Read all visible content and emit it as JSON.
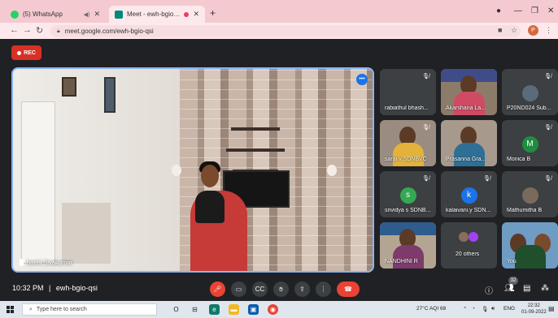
{
  "browser": {
    "tabs": [
      {
        "title": "(5) WhatsApp",
        "active": false,
        "favicon_color": "#25d366"
      },
      {
        "title": "Meet - ewh-bgio-qsi",
        "active": true,
        "favicon_color": "#00897b"
      }
    ],
    "url": "meet.google.com/ewh-bgio-qsi",
    "new_tab_label": "+",
    "profile_initial": "P"
  },
  "meet": {
    "rec_label": "REC",
    "main_speaker": "harini Sivakumar",
    "participants": [
      {
        "name": "rabiathul bhash...",
        "kind": "blank"
      },
      {
        "name": "Akarshana La...",
        "kind": "photo"
      },
      {
        "name": "P20ND024 Sub...",
        "kind": "avatar",
        "initial": "",
        "color": "#5b6b7a"
      },
      {
        "name": "sarai v SDNBVC",
        "kind": "photo"
      },
      {
        "name": "Prasanna Gra...",
        "kind": "photo"
      },
      {
        "name": "Monica B",
        "kind": "avatar",
        "initial": "M",
        "color": "#1e8e3e"
      },
      {
        "name": "srividya s SDNB...",
        "kind": "avatar",
        "initial": "s",
        "color": "#34a853"
      },
      {
        "name": "kalaivani.y SDN...",
        "kind": "avatar",
        "initial": "k",
        "color": "#1a73e8"
      },
      {
        "name": "Mathumitha B",
        "kind": "avatar",
        "initial": "",
        "color": "#7a6a5c"
      },
      {
        "name": "NANDHINI R",
        "kind": "photo"
      },
      {
        "name": "20 others",
        "kind": "group"
      },
      {
        "name": "You",
        "kind": "photo"
      }
    ],
    "time": "10:32 PM",
    "separator": "|",
    "meeting_code": "ewh-bgio-qsi",
    "participant_count": "32"
  },
  "taskbar": {
    "search_placeholder": "Type here to search",
    "weather": "27°C  AQI 68",
    "language": "ENG",
    "clock_time": "22:32",
    "clock_date": "01-09-2022"
  }
}
